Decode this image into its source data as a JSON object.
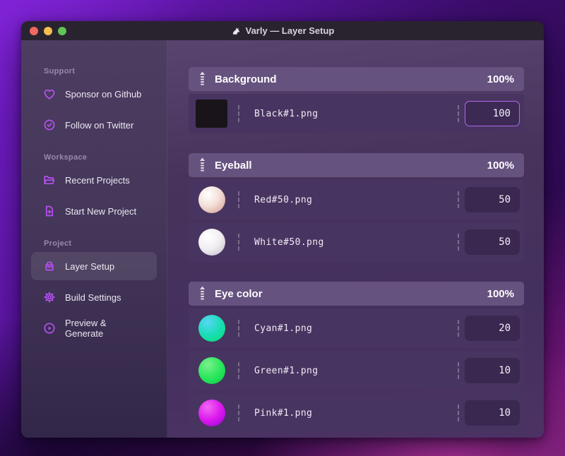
{
  "window": {
    "title": "Varly — Layer Setup",
    "app_icon": "unicorn-icon"
  },
  "traffic_lights": [
    {
      "name": "close",
      "color": "#ed6a5e"
    },
    {
      "name": "minimize",
      "color": "#f5bf4f"
    },
    {
      "name": "zoom",
      "color": "#61c454"
    }
  ],
  "sidebar": {
    "sections": [
      {
        "label": "Support",
        "items": [
          {
            "icon": "heart-icon",
            "label": "Sponsor on Github"
          },
          {
            "icon": "badge-check-icon",
            "label": "Follow on Twitter"
          }
        ]
      },
      {
        "label": "Workspace",
        "items": [
          {
            "icon": "folder-icon",
            "label": "Recent Projects"
          },
          {
            "icon": "file-plus-icon",
            "label": "Start New Project"
          }
        ]
      },
      {
        "label": "Project",
        "items": [
          {
            "icon": "archive-icon",
            "label": "Layer Setup",
            "active": true
          },
          {
            "icon": "gear-icon",
            "label": "Build Settings"
          },
          {
            "icon": "play-circle-icon",
            "label": "Preview & Generate"
          }
        ]
      }
    ]
  },
  "groups": [
    {
      "name": "Background",
      "weight": "100%",
      "layers": [
        {
          "file": "Black#1.png",
          "value": "100",
          "thumb": "black-square",
          "focused": true
        }
      ]
    },
    {
      "name": "Eyeball",
      "weight": "100%",
      "layers": [
        {
          "file": "Red#50.png",
          "value": "50",
          "thumb": "red-pearl"
        },
        {
          "file": "White#50.png",
          "value": "50",
          "thumb": "white-pearl"
        }
      ]
    },
    {
      "name": "Eye color",
      "weight": "100%",
      "layers": [
        {
          "file": "Cyan#1.png",
          "value": "20",
          "thumb": "cyan-ball"
        },
        {
          "file": "Green#1.png",
          "value": "10",
          "thumb": "green-ball"
        },
        {
          "file": "Pink#1.png",
          "value": "10",
          "thumb": "pink-ball"
        }
      ]
    }
  ],
  "colors": {
    "accent_icon": "#b750f3",
    "focused_input_border": "#b168f0",
    "group_header_bg": "#66527f",
    "layer_row_bg": "#483460",
    "thumb_cyan": "#0ae085",
    "thumb_green": "#1ee858",
    "thumb_pink": "#d714ea"
  }
}
